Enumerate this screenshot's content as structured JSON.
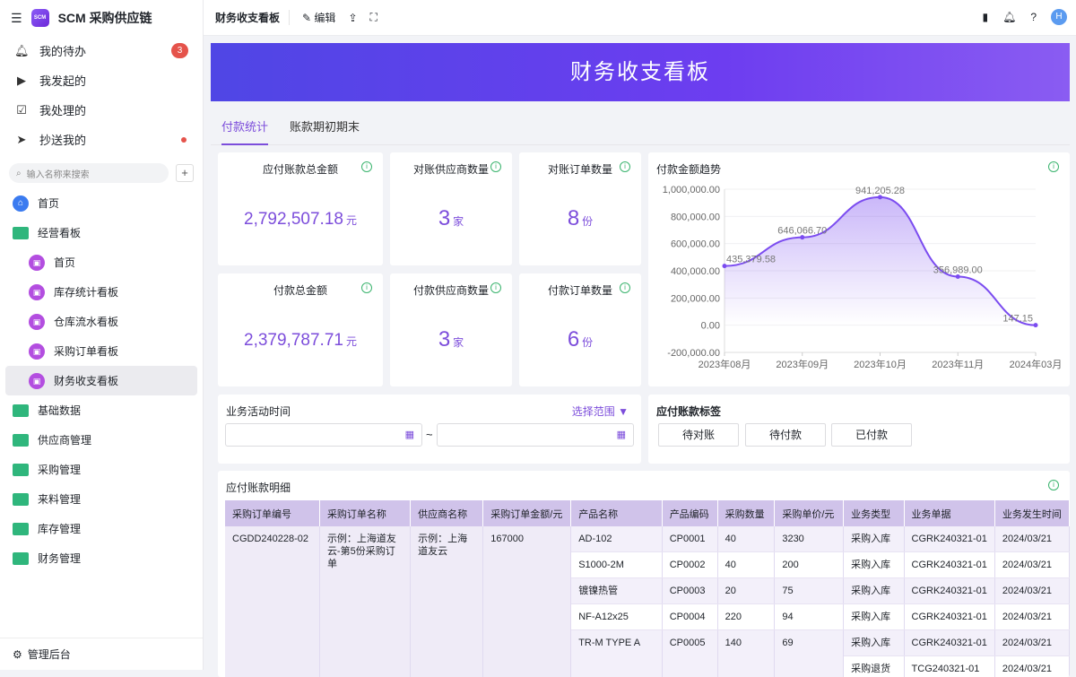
{
  "app": {
    "name": "SCM 采购供应链",
    "logo_text": "SCM"
  },
  "sidebar": {
    "quick": [
      {
        "label": "我的待办",
        "badge": "3"
      },
      {
        "label": "我发起的"
      },
      {
        "label": "我处理的"
      },
      {
        "label": "抄送我的"
      }
    ],
    "search_placeholder": "输入名称来搜索",
    "tree": [
      {
        "label": "首页"
      },
      {
        "label": "经营看板"
      },
      {
        "label": "首页"
      },
      {
        "label": "库存统计看板"
      },
      {
        "label": "仓库流水看板"
      },
      {
        "label": "采购订单看板"
      },
      {
        "label": "财务收支看板"
      },
      {
        "label": "基础数据"
      },
      {
        "label": "供应商管理"
      },
      {
        "label": "采购管理"
      },
      {
        "label": "来料管理"
      },
      {
        "label": "库存管理"
      },
      {
        "label": "财务管理"
      }
    ],
    "admin": "管理后台"
  },
  "topbar": {
    "title": "财务收支看板",
    "edit": "编辑",
    "avatar": "H"
  },
  "banner": {
    "title": "财务收支看板"
  },
  "tabs": [
    "付款统计",
    "账款期初期末"
  ],
  "stats": [
    {
      "label": "应付账款总金额",
      "value": "2,792,507.18",
      "unit": "元"
    },
    {
      "label": "对账供应商数量",
      "value": "3",
      "unit": "家"
    },
    {
      "label": "对账订单数量",
      "value": "8",
      "unit": "份"
    },
    {
      "label": "付款总金额",
      "value": "2,379,787.71",
      "unit": "元"
    },
    {
      "label": "付款供应商数量",
      "value": "3",
      "unit": "家"
    },
    {
      "label": "付款订单数量",
      "value": "6",
      "unit": "份"
    }
  ],
  "chart_data": {
    "type": "area",
    "title": "付款金额趋势",
    "categories": [
      "2023年08月",
      "2023年09月",
      "2023年10月",
      "2023年11月",
      "2024年03月"
    ],
    "values": [
      435379.58,
      646066.7,
      941205.28,
      356989.0,
      147.15
    ],
    "labels": [
      "435,379.58",
      "646,066.70",
      "941,205.28",
      "356,989.00",
      "147.15"
    ],
    "ylim": [
      -200000,
      1000000
    ],
    "yticks": [
      "1,000,000.00",
      "800,000.00",
      "600,000.00",
      "400,000.00",
      "200,000.00",
      "0.00",
      "-200,000.00"
    ],
    "color": "#7b4cf0"
  },
  "filter": {
    "label": "业务活动时间",
    "range": "选择范围",
    "sep": "~"
  },
  "tags": {
    "title": "应付账款标签",
    "items": [
      "待对账",
      "待付款",
      "已付款"
    ]
  },
  "detail": {
    "title": "应付账款明细",
    "headers": [
      "采购订单编号",
      "采购订单名称",
      "供应商名称",
      "采购订单金额/元",
      "产品名称",
      "产品编码",
      "采购数量",
      "采购单价/元",
      "业务类型",
      "业务单据",
      "业务发生时间"
    ],
    "order": {
      "no": "CGDD240228-02",
      "name": "示例：上海道友云-第5份采购订单",
      "supplier": "示例：上海道友云",
      "amount": "167000"
    },
    "rows": [
      {
        "product": "AD-102",
        "code": "CP0001",
        "qty": "40",
        "price": "3230",
        "type": "采购入库",
        "doc": "CGRK240321-01",
        "date": "2024/03/21"
      },
      {
        "product": "S1000-2M",
        "code": "CP0002",
        "qty": "40",
        "price": "200",
        "type": "采购入库",
        "doc": "CGRK240321-01",
        "date": "2024/03/21"
      },
      {
        "product": "镀镍热管",
        "code": "CP0003",
        "qty": "20",
        "price": "75",
        "type": "采购入库",
        "doc": "CGRK240321-01",
        "date": "2024/03/21"
      },
      {
        "product": "NF-A12x25",
        "code": "CP0004",
        "qty": "220",
        "price": "94",
        "type": "采购入库",
        "doc": "CGRK240321-01",
        "date": "2024/03/21"
      },
      {
        "product": "TR-M TYPE A",
        "code": "CP0005",
        "qty": "140",
        "price": "69",
        "type": "采购入库",
        "doc": "CGRK240321-01",
        "date": "2024/03/21"
      },
      {
        "type": "采购退货",
        "doc": "TCG240321-01",
        "date": "2024/03/21"
      }
    ]
  }
}
